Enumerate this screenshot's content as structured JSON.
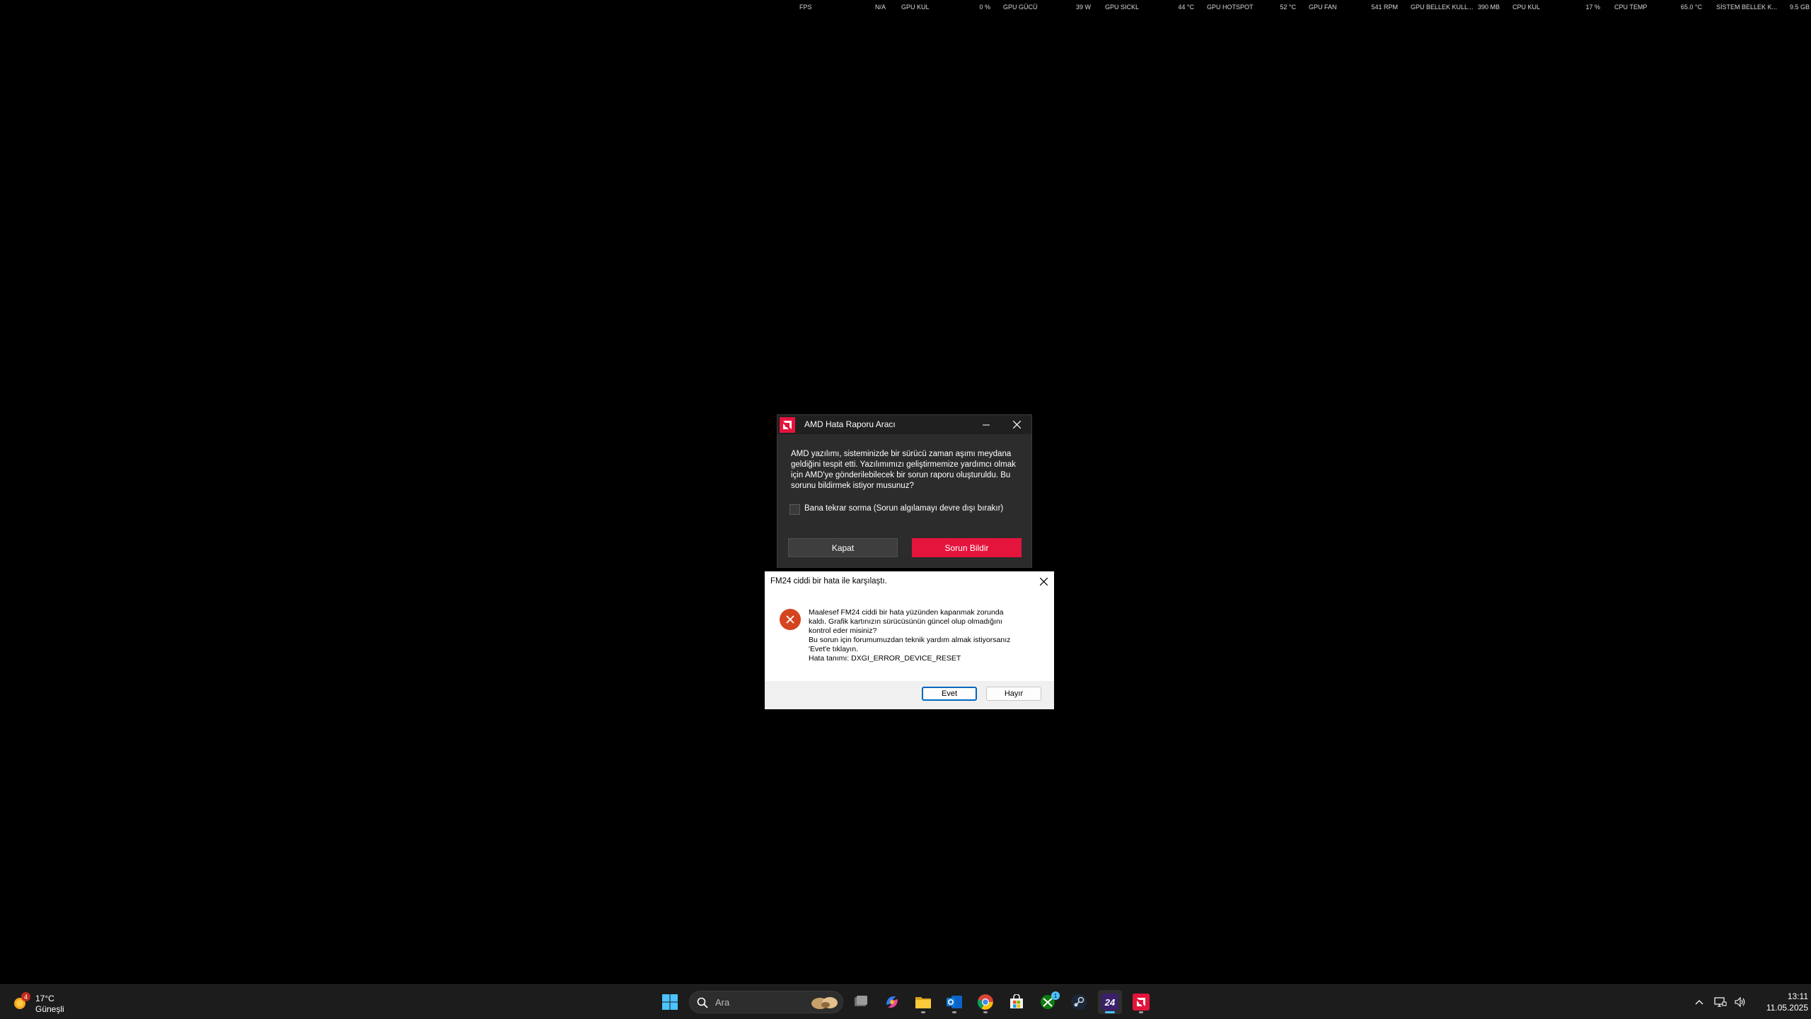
{
  "osd": {
    "items": [
      {
        "label": "FPS",
        "value": "N/A"
      },
      {
        "label": "GPU KUL",
        "value": "0 %"
      },
      {
        "label": "GPU GÜCÜ",
        "value": "39 W"
      },
      {
        "label": "GPU SICKL",
        "value": "44 °C"
      },
      {
        "label": "GPU HOTSPOT",
        "value": "52 °C"
      },
      {
        "label": "GPU FAN",
        "value": "541 RPM"
      },
      {
        "label": "GPU BELLEK KULL...",
        "value": "390 MB"
      },
      {
        "label": "CPU KUL",
        "value": "17 %"
      },
      {
        "label": "CPU TEMP",
        "value": "65.0 °C"
      },
      {
        "label": "SİSTEM BELLEK K...",
        "value": "9.5 GB"
      }
    ]
  },
  "amd_dialog": {
    "title": "AMD Hata Raporu Aracı",
    "message": "AMD yazılımı, sisteminizde bir sürücü zaman aşımı meydana geldiğini tespit etti. Yazılımımızı geliştirmemize yardımcı olmak için AMD'ye gönderilebilecek bir sorun raporu oluşturuldu. Bu sorunu bildirmek istiyor musunuz?",
    "checkbox_label": "Bana tekrar sorma (Sorun algılamayı devre dışı bırakır)",
    "close_button": "Kapat",
    "report_button": "Sorun Bildir",
    "accent_color": "#e4143c"
  },
  "fm_dialog": {
    "title": "FM24 ciddi bir hata ile karşılaştı.",
    "message_lines": [
      "Maalesef FM24 ciddi bir hata yüzünden kapanmak zorunda",
      "kaldı. Grafik kartınızın sürücüsünün güncel olup olmadığını",
      "kontrol eder misiniz?",
      "Bu sorun için forumumuzdan teknik yardım almak istiyorsanız",
      "'Evet'e tıklayın.",
      "Hata tanımı: DXGI_ERROR_DEVICE_RESET"
    ],
    "yes_button": "Evet",
    "no_button": "Hayır",
    "error_icon_color": "#d4451f"
  },
  "taskbar": {
    "weather": {
      "temp": "17°C",
      "condition": "Güneşli",
      "badge": "4"
    },
    "search_placeholder": "Ara",
    "apps": [
      {
        "name": "start-icon"
      },
      {
        "name": "task-view-icon"
      },
      {
        "name": "copilot-icon"
      },
      {
        "name": "file-explorer-icon"
      },
      {
        "name": "outlook-icon"
      },
      {
        "name": "chrome-icon"
      },
      {
        "name": "microsoft-store-icon"
      },
      {
        "name": "xbox-icon",
        "badge": "1"
      },
      {
        "name": "steam-icon"
      },
      {
        "name": "fm24-icon",
        "label": "24"
      },
      {
        "name": "amd-software-icon"
      }
    ],
    "clock": {
      "time": "13:11",
      "date": "11.05.2025"
    }
  }
}
